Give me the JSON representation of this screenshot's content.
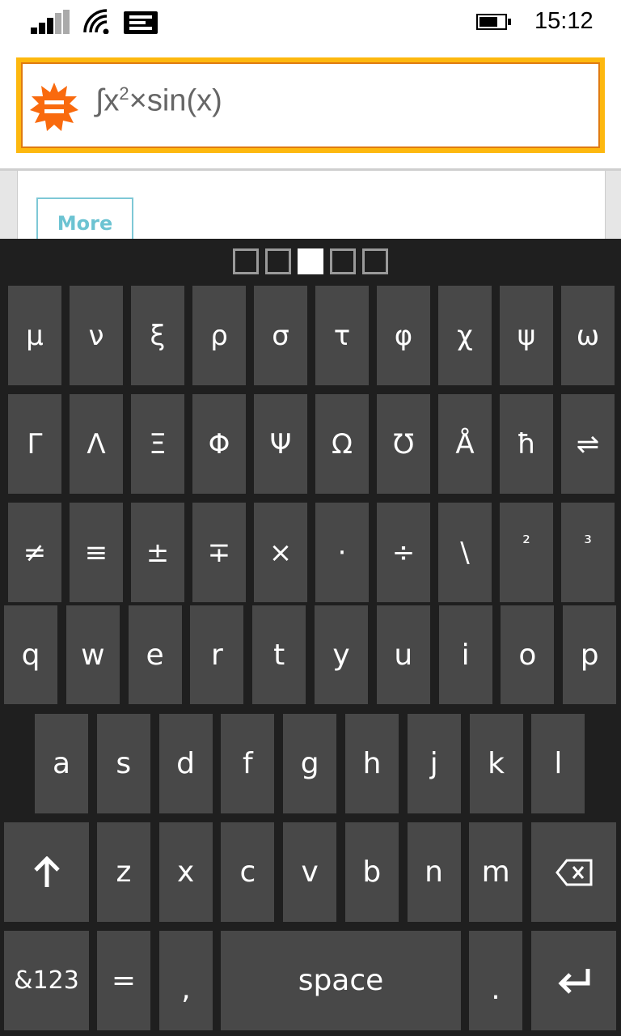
{
  "status_bar": {
    "time": "15:12",
    "signal_bars": 3,
    "signal_max": 5,
    "battery_level": 0.7,
    "icons": [
      "signal-icon",
      "wifi-icon",
      "message-icon",
      "battery-icon"
    ]
  },
  "search": {
    "query_prefix": "∫x",
    "query_sup": "2",
    "query_suffix": "×sin(x)",
    "logo_icon": "wolfram-alpha-logo",
    "border_color": "#fdb80f",
    "logo_color": "#f96a0e"
  },
  "content": {
    "more_label": "More"
  },
  "keyboard": {
    "page_count": 5,
    "current_page": 3,
    "symbol_rows": [
      [
        "μ",
        "ν",
        "ξ",
        "ρ",
        "σ",
        "τ",
        "φ",
        "χ",
        "ψ",
        "ω"
      ],
      [
        "Γ",
        "Λ",
        "Ξ",
        "Φ",
        "Ψ",
        "Ω",
        "℧",
        "Å",
        "ħ",
        "⇌"
      ],
      [
        "≠",
        "≡",
        "±",
        "∓",
        "×",
        "·",
        "÷",
        "\\",
        "²",
        "³"
      ]
    ],
    "letter_rows": [
      [
        "q",
        "w",
        "e",
        "r",
        "t",
        "y",
        "u",
        "i",
        "o",
        "p"
      ],
      [
        "a",
        "s",
        "d",
        "f",
        "g",
        "h",
        "j",
        "k",
        "l"
      ],
      [
        "z",
        "x",
        "c",
        "v",
        "b",
        "n",
        "m"
      ]
    ],
    "shift_icon": "shift-arrow-icon",
    "backspace_icon": "backspace-icon",
    "enter_icon": "enter-icon",
    "bottom_row": {
      "numbers_label": "&123",
      "equals_label": "=",
      "comma_label": ",",
      "space_label": "space",
      "period_label": "."
    }
  }
}
